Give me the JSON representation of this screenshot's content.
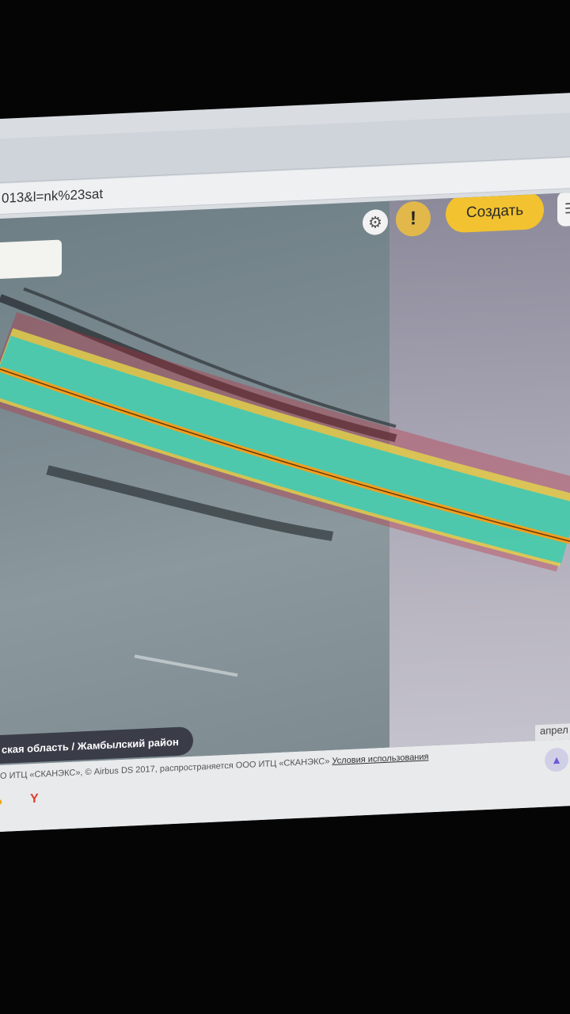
{
  "browser": {
    "address": "013&l=nk%23sat"
  },
  "map": {
    "controls": {
      "settings_icon": "gear-icon",
      "alert_label": "!",
      "create_label": "Создать",
      "more_icon": "menu-icon"
    },
    "region_label": "ская область / Жамбылский район",
    "date_label": "апрел"
  },
  "footer": {
    "copyright": "О ИТЦ «СКАНЭКС», © Airbus DS 2017, распространяется ООО ИТЦ «СКАНЭКС»",
    "terms_link": "Условия использования"
  },
  "taskbar": {
    "yandex_letter": "Y"
  },
  "colors": {
    "create_button": "#f2c230",
    "alert_button": "#e2b84a",
    "route_line": "#f0a020",
    "traffic_band": "#3ec9b6"
  }
}
